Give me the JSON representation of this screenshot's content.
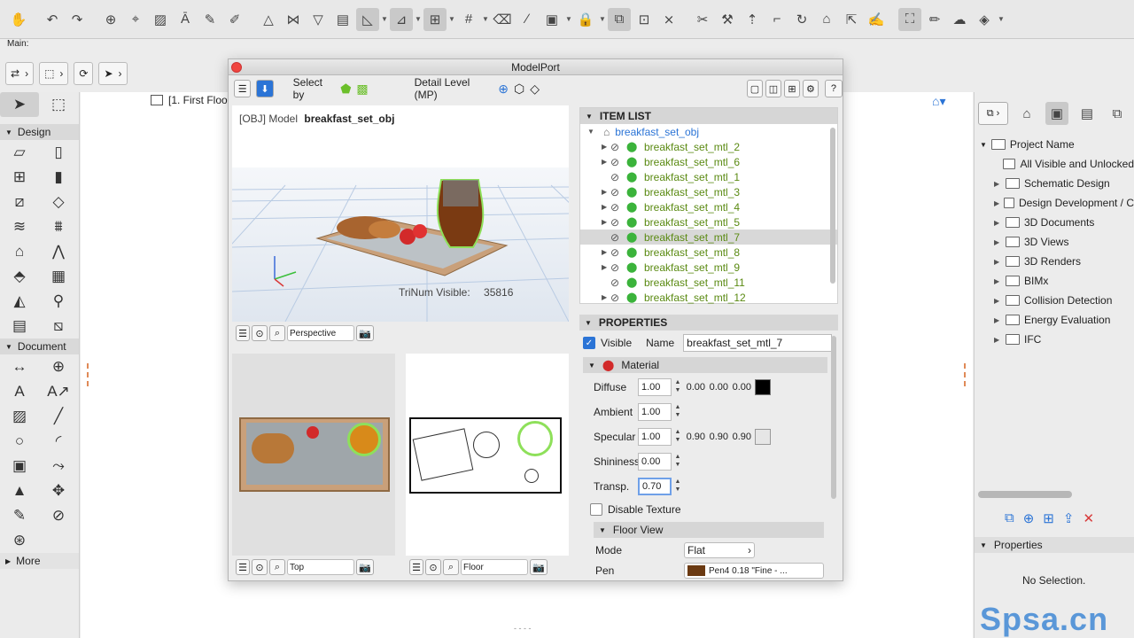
{
  "toolbar": {
    "main_label": "Main:"
  },
  "left_palette": {
    "design_label": "Design",
    "document_label": "Document",
    "more_label": "More"
  },
  "canvas": {
    "tab_label": "[1. First Floo"
  },
  "modelport": {
    "title": "ModelPort",
    "select_by_label": "Select by",
    "detail_level_label": "Detail Level (MP)",
    "model_prefix": "[OBJ] Model",
    "model_name": "breakfast_set_obj",
    "trinum_label": "TriNum Visible:",
    "trinum_value": "35816",
    "view_perspective": "Perspective",
    "view_top": "Top",
    "view_floor": "Floor",
    "item_list": {
      "header": "ITEM LIST",
      "root": "breakfast_set_obj",
      "items": [
        "breakfast_set_mtl_2",
        "breakfast_set_mtl_6",
        "breakfast_set_mtl_1",
        "breakfast_set_mtl_3",
        "breakfast_set_mtl_4",
        "breakfast_set_mtl_5",
        "breakfast_set_mtl_7",
        "breakfast_set_mtl_8",
        "breakfast_set_mtl_9",
        "breakfast_set_mtl_11",
        "breakfast_set_mtl_12"
      ],
      "selected_index": 6
    },
    "properties": {
      "header": "PROPERTIES",
      "visible_label": "Visible",
      "name_label": "Name",
      "name_value": "breakfast_set_mtl_7",
      "material_label": "Material",
      "diffuse_label": "Diffuse",
      "diffuse_value": "1.00",
      "diffuse_rgb": [
        "0.00",
        "0.00",
        "0.00"
      ],
      "ambient_label": "Ambient",
      "ambient_value": "1.00",
      "specular_label": "Specular",
      "specular_value": "1.00",
      "specular_rgb": [
        "0.90",
        "0.90",
        "0.90"
      ],
      "shininess_label": "Shininess",
      "shininess_value": "0.00",
      "transp_label": "Transp.",
      "transp_value": "0.70",
      "disable_texture_label": "Disable Texture",
      "floor_view_label": "Floor View",
      "mode_label": "Mode",
      "mode_value": "Flat",
      "pen_label": "Pen",
      "pen_value": "Pen4    0.18  \"Fine - ..."
    }
  },
  "navigator": {
    "project_name": "Project Name",
    "items": [
      "All Visible and Unlocked",
      "Schematic Design",
      "Design Development / C",
      "3D Documents",
      "3D Views",
      "3D Renders",
      "BIMx",
      "Collision Detection",
      "Energy Evaluation",
      "IFC"
    ],
    "properties_label": "Properties",
    "no_selection": "No Selection."
  },
  "watermark": "Spsa.cn",
  "colors": {
    "item_green": "#5a8a12",
    "selected_row": "#d8d8d8",
    "accent_blue": "#2b74d6"
  }
}
